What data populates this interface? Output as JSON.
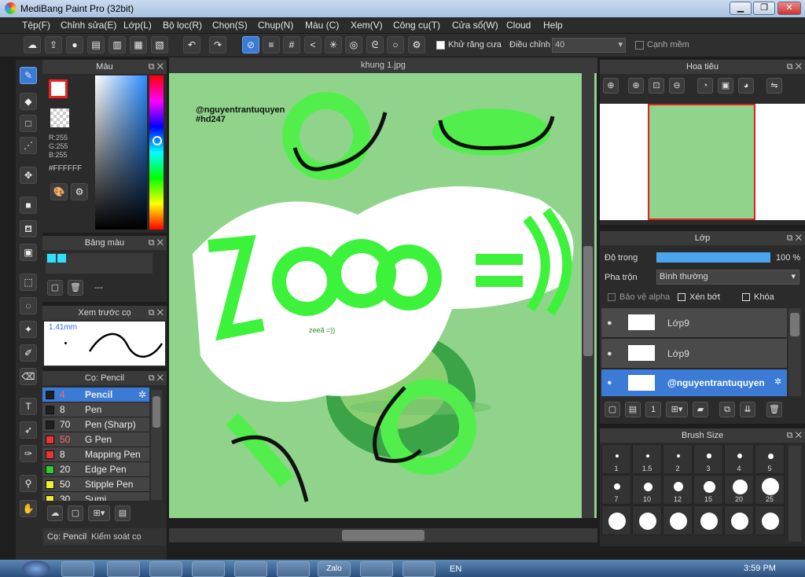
{
  "window": {
    "title": "MediBang Paint Pro (32bit)",
    "min": "▁",
    "max": "❐",
    "close": "✕"
  },
  "menu": [
    "Tệp(F)",
    "Chỉnh sửa(E)",
    "Lớp(L)",
    "Bộ lọc(R)",
    "Chọn(S)",
    "Chụp(N)",
    "Màu (C)",
    "Xem(V)",
    "Công cụ(T)",
    "Cửa sổ(W)",
    "Cloud",
    "Help"
  ],
  "toolbar": {
    "antialias_label": "Khử răng cưa",
    "adjust_label": "Điều chỉnh",
    "adjust_value": "40",
    "soften_label": "Cạnh mềm"
  },
  "color_panel": {
    "title": "Màu",
    "r": "R:255",
    "g": "G:255",
    "b": "B:255",
    "hex": "#FFFFFF"
  },
  "palette_panel": {
    "title": "Bảng màu",
    "value": "---"
  },
  "preview_panel": {
    "title": "Xem trước cọ",
    "size": "1.41mm"
  },
  "brush_panel": {
    "title": "Cọ: Pencil",
    "items": [
      {
        "size": "4",
        "name": "Pencil",
        "color": "#202020"
      },
      {
        "size": "8",
        "name": "Pen",
        "color": "#202020"
      },
      {
        "size": "70",
        "name": "Pen (Sharp)",
        "color": "#202020"
      },
      {
        "size": "50",
        "name": "G Pen",
        "color": "#e33"
      },
      {
        "size": "8",
        "name": "Mapping Pen",
        "color": "#e33"
      },
      {
        "size": "20",
        "name": "Edge Pen",
        "color": "#3c3"
      },
      {
        "size": "50",
        "name": "Stipple Pen",
        "color": "#ee3"
      },
      {
        "size": "30",
        "name": "Sumi",
        "color": "#ee3"
      }
    ],
    "tabs": [
      "Cọ: Pencil",
      "Kiểm soát cọ"
    ]
  },
  "canvas": {
    "tab": "khung 1.jpg",
    "credit": "@nguyentrantuquyen",
    "tag": "#hd247",
    "art_text": "zeeã =))"
  },
  "navigator": {
    "title": "Hoa tiêu"
  },
  "layers": {
    "title": "Lớp",
    "opacity_label": "Độ trong",
    "opacity_value": "100 %",
    "opacity": 1.0,
    "blend_label": "Pha trộn",
    "blend_value": "Bình thường",
    "protect_alpha": "Bảo vệ alpha",
    "clip": "Xén bớt",
    "lock": "Khóa",
    "items": [
      {
        "name": "Lớp9"
      },
      {
        "name": "Lớp9"
      },
      {
        "name": "@nguyentrantuquyen"
      }
    ]
  },
  "brush_size": {
    "title": "Brush Size",
    "sizes": [
      "1",
      "1.5",
      "2",
      "3",
      "4",
      "5",
      "7",
      "10",
      "12",
      "15",
      "20",
      "25"
    ]
  },
  "taskbar": {
    "lang": "EN",
    "time": "3:59 PM",
    "zalo": "Zalo"
  }
}
